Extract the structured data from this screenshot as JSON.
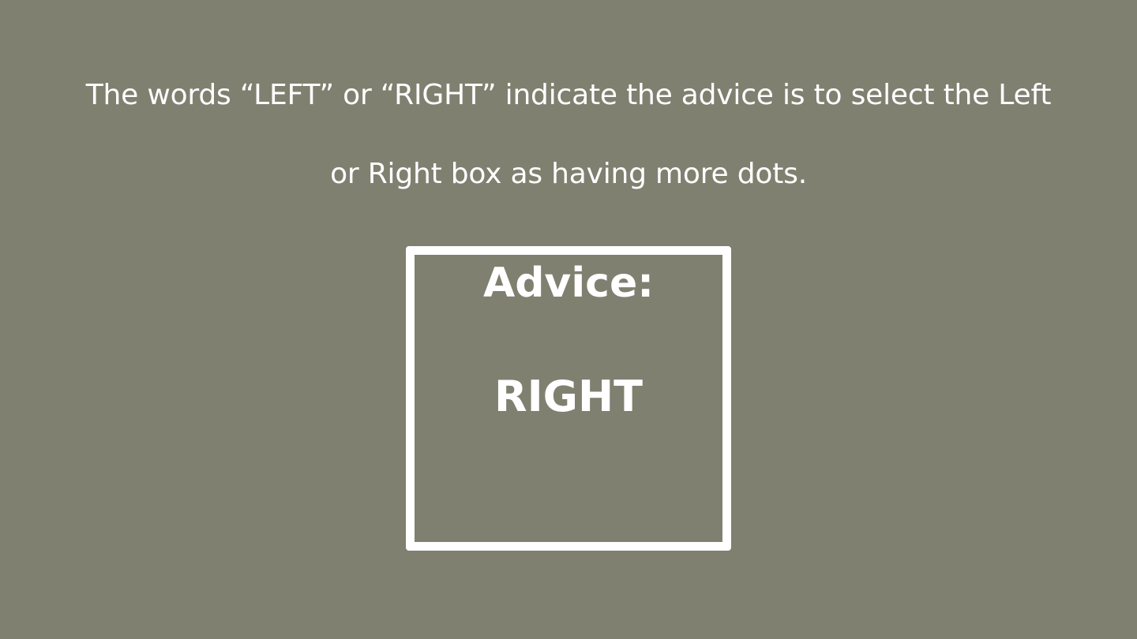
{
  "instruction": {
    "line1": "The words “LEFT” or “RIGHT” indicate the advice is to select the Left",
    "line2": "or Right box as having more dots."
  },
  "advice": {
    "label": "Advice:",
    "value": "RIGHT"
  },
  "colors": {
    "background": "#7f8070",
    "foreground": "#ffffff"
  }
}
